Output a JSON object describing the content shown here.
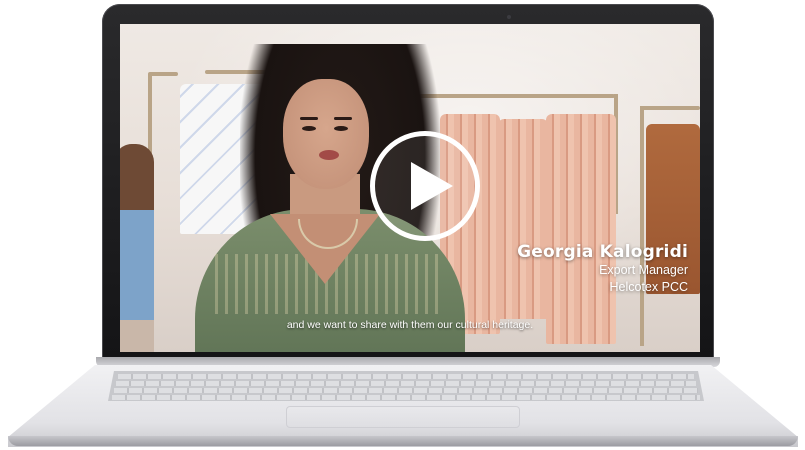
{
  "video": {
    "speaker_name": "Georgia Kalogridi",
    "speaker_role": "Export Manager",
    "speaker_company": "Helcotex PCC",
    "subtitle": "and we want to share with them our cultural heritage.",
    "play_icon": "play-icon"
  },
  "colors": {
    "laptop_bezel": "#1b1b1d",
    "play_button": "#ffffff",
    "caption_text": "#ffffff"
  }
}
